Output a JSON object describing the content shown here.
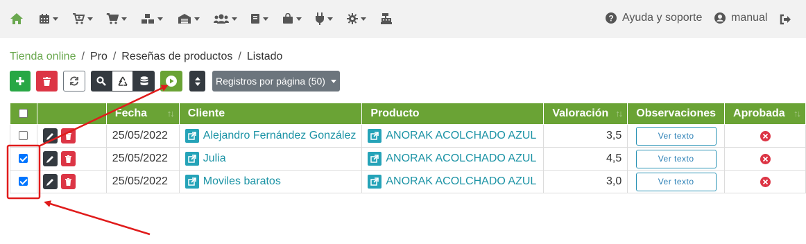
{
  "topbar": {
    "icons": [
      "home-icon",
      "calendar-icon",
      "cart-plus-icon",
      "cart-icon",
      "boxes-icon",
      "warehouse-icon",
      "users-icon",
      "book-icon",
      "shopping-bag-icon",
      "plug-icon",
      "cog-icon",
      "cash-register-icon"
    ],
    "help_label": "Ayuda y soporte",
    "user_label": "manual"
  },
  "breadcrumb": [
    "Tienda online",
    "Pro",
    "Reseñas de productos",
    "Listado"
  ],
  "toolbar": {
    "per_page_label": "Registros por página (50)"
  },
  "table": {
    "headers": [
      "Fecha",
      "Cliente",
      "Producto",
      "Valoración",
      "Observaciones",
      "Aprobada"
    ],
    "view_text_label": "Ver texto",
    "rows": [
      {
        "checked": false,
        "fecha": "25/05/2022",
        "cliente": "Alejandro Fernández González",
        "producto": "ANORAK ACOLCHADO AZUL",
        "valoracion": "3,5",
        "aprobada": false
      },
      {
        "checked": true,
        "fecha": "25/05/2022",
        "cliente": "Julia",
        "producto": "ANORAK ACOLCHADO AZUL",
        "valoracion": "4,5",
        "aprobada": false
      },
      {
        "checked": true,
        "fecha": "25/05/2022",
        "cliente": "Moviles baratos",
        "producto": "ANORAK ACOLCHADO AZUL",
        "valoracion": "3,0",
        "aprobada": false
      }
    ]
  },
  "colors": {
    "green": "#6aa335",
    "red": "#dc3545",
    "dark": "#343a40",
    "teal": "#25a3b8",
    "annotation": "#e01b1b"
  }
}
